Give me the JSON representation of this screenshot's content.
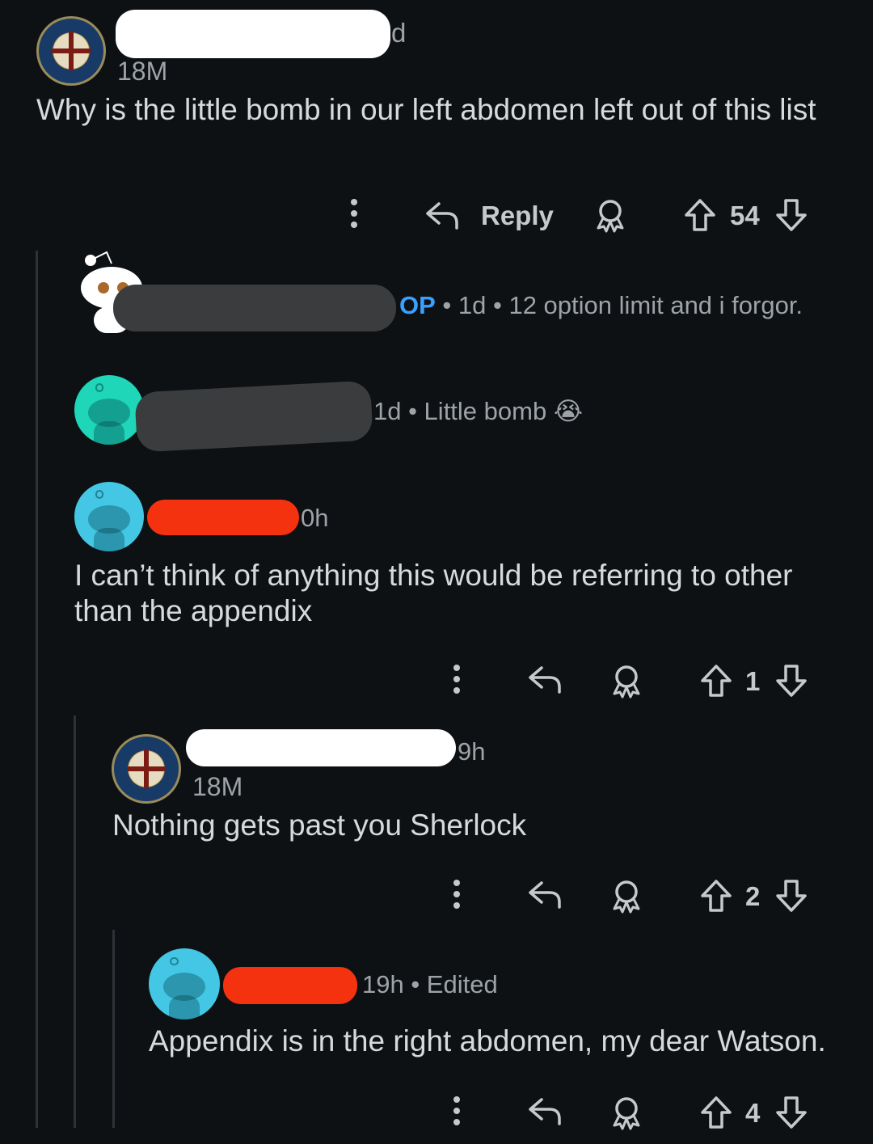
{
  "comments": [
    {
      "meta": "18M",
      "body": "Why is the little bomb in our left abdomen left out of this list",
      "username_suffix": "d",
      "actions": {
        "reply_label": "Reply",
        "votes": "54"
      }
    },
    {
      "op_label": "OP",
      "meta": "• 1d • 12 option limit and i forgor."
    },
    {
      "meta": "1d • Little bomb 😭"
    },
    {
      "meta": "0h",
      "body": "I can’t think of anything this would be referring to other than the appendix",
      "actions": {
        "votes": "1"
      }
    },
    {
      "time": "9h",
      "meta": "18M",
      "body": "Nothing gets past you Sherlock",
      "actions": {
        "votes": "2"
      }
    },
    {
      "meta": "19h • Edited",
      "body": "Appendix is in the right abdomen, my dear Watson.",
      "actions": {
        "votes": "4"
      }
    }
  ],
  "icons": {
    "more": "more-vertical-icon",
    "reply": "reply-arrow-icon",
    "award": "award-icon",
    "upvote": "upvote-arrow-icon",
    "downvote": "downvote-arrow-icon"
  },
  "colors": {
    "background": "#0e1114",
    "op_blue": "#3aa0ff",
    "redaction_red": "#f5320f"
  }
}
